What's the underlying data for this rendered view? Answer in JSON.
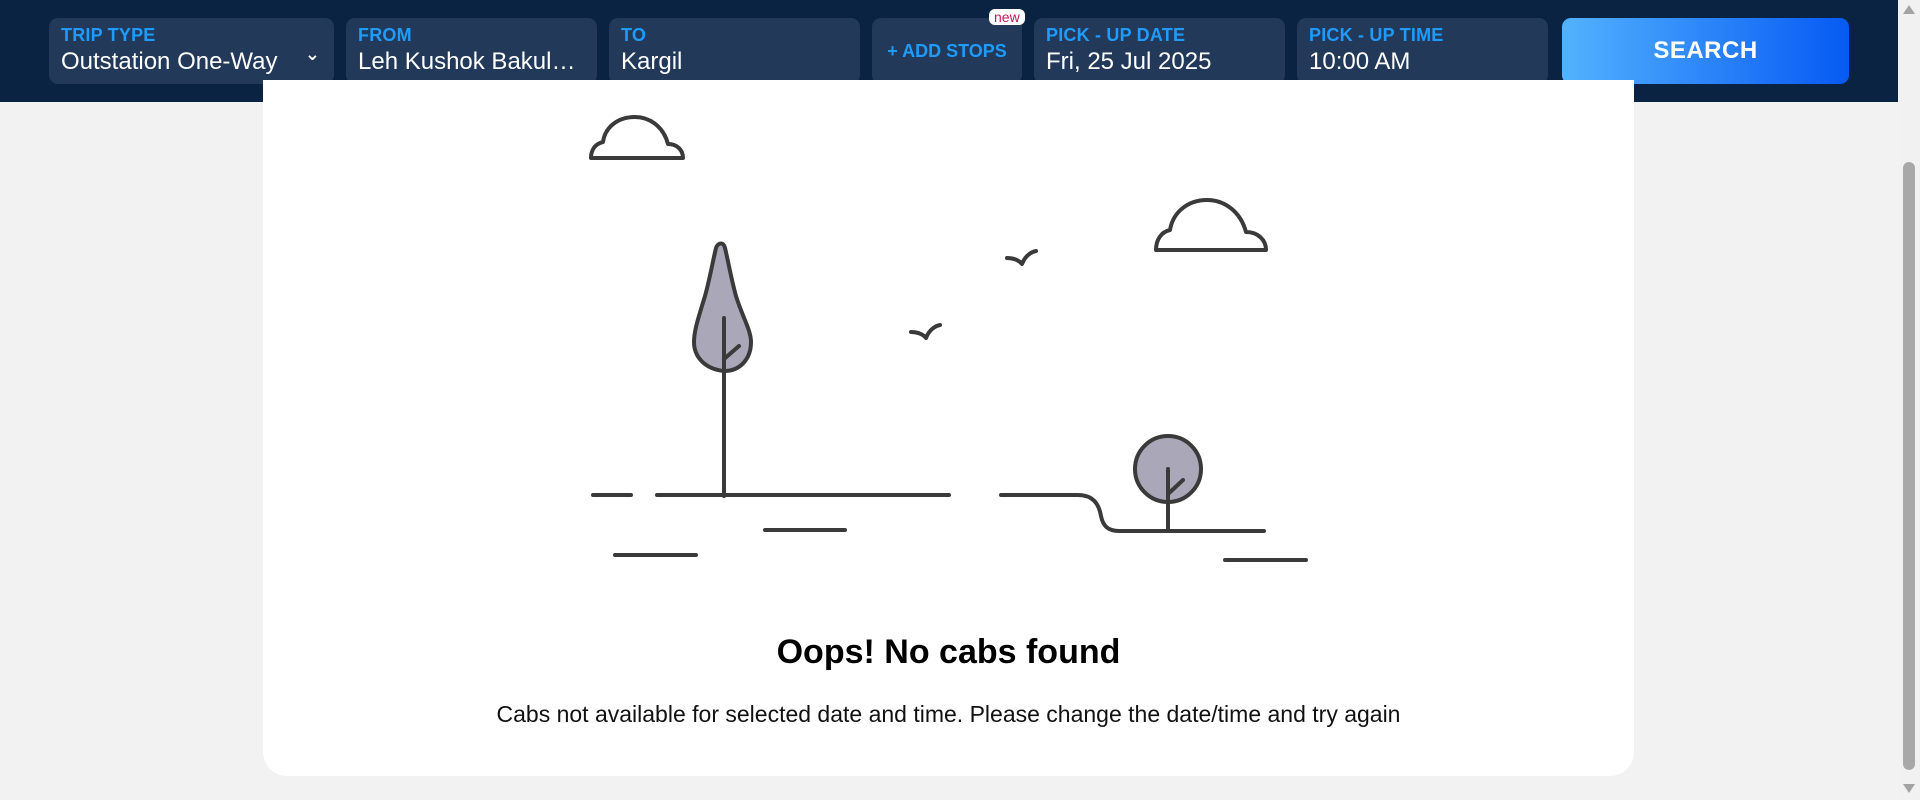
{
  "search_bar": {
    "trip_type": {
      "label": "TRIP TYPE",
      "value": "Outstation One-Way"
    },
    "from": {
      "label": "FROM",
      "value": "Leh Kushok Bakula ..."
    },
    "to": {
      "label": "TO",
      "value": "Kargil"
    },
    "add_stops": {
      "label": "+ ADD STOPS",
      "badge": "new"
    },
    "pickup_date": {
      "label": "PICK - UP DATE",
      "value": "Fri, 25 Jul 2025"
    },
    "pickup_time": {
      "label": "PICK - UP TIME",
      "value": "10:00 AM"
    },
    "search_label": "SEARCH"
  },
  "result": {
    "title": "Oops! No cabs found",
    "message": "Cabs not available for selected date and time. Please change the date/time and try again"
  },
  "colors": {
    "header_bg": "#0b2342",
    "field_bg": "#22395a",
    "label_blue": "#1f9bff",
    "search_gradient_start": "#53b2fe",
    "search_gradient_end": "#065af3",
    "illustration_stroke": "#3a3a3a",
    "illustration_fill": "#a9a7b8"
  },
  "icons": [
    "chevron-down-icon",
    "cloud-icon",
    "bird-icon",
    "tree-icon"
  ]
}
